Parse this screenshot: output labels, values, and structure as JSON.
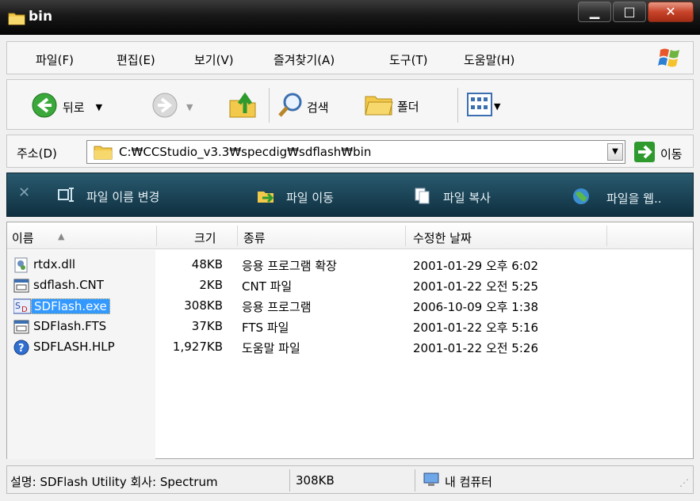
{
  "window": {
    "title": "bin"
  },
  "menu": [
    {
      "label": "파일(F)"
    },
    {
      "label": "편집(E)"
    },
    {
      "label": "보기(V)"
    },
    {
      "label": "즐겨찾기(A)"
    },
    {
      "label": "도구(T)"
    },
    {
      "label": "도움말(H)"
    }
  ],
  "toolbar": {
    "back_label": "뒤로",
    "search_label": "검색",
    "folders_label": "폴더"
  },
  "address": {
    "label": "주소(D)",
    "path": "C:₩CCStudio_v3.3₩specdig₩sdflash₩bin",
    "go_label": "이동"
  },
  "tasks": [
    {
      "label": "파일 이름 변경",
      "icon": "rename-icon"
    },
    {
      "label": "파일 이동",
      "icon": "move-icon"
    },
    {
      "label": "파일 복사",
      "icon": "copy-icon"
    },
    {
      "label": "파일을 웹..",
      "icon": "web-publish-icon"
    }
  ],
  "columns": {
    "name": "이름",
    "size": "크기",
    "type": "종류",
    "modified": "수정한 날짜"
  },
  "files": [
    {
      "name": "rtdx.dll",
      "size": "48KB",
      "type": "응용 프로그램 확장",
      "modified": "2001-01-29 오후 6:02",
      "icon": "dll-icon",
      "selected": false
    },
    {
      "name": "sdflash.CNT",
      "size": "2KB",
      "type": "CNT 파일",
      "modified": "2001-01-22 오전 5:25",
      "icon": "cnt-file-icon",
      "selected": false
    },
    {
      "name": "SDFlash.exe",
      "size": "308KB",
      "type": "응용 프로그램",
      "modified": "2006-10-09 오후 1:38",
      "icon": "sdflash-app-icon",
      "selected": true
    },
    {
      "name": "SDFlash.FTS",
      "size": "37KB",
      "type": "FTS 파일",
      "modified": "2001-01-22 오후 5:16",
      "icon": "fts-file-icon",
      "selected": false
    },
    {
      "name": "SDFLASH.HLP",
      "size": "1,927KB",
      "type": "도움말 파일",
      "modified": "2001-01-22 오전 5:26",
      "icon": "help-file-icon",
      "selected": false
    }
  ],
  "status": {
    "description": "설명: SDFlash Utility 회사: Spectrum",
    "size": "308KB",
    "location": "내 컴퓨터"
  },
  "colors": {
    "selection": "#3399ff",
    "taskbar": "#1c4558",
    "go_green": "#2e9a2e"
  }
}
